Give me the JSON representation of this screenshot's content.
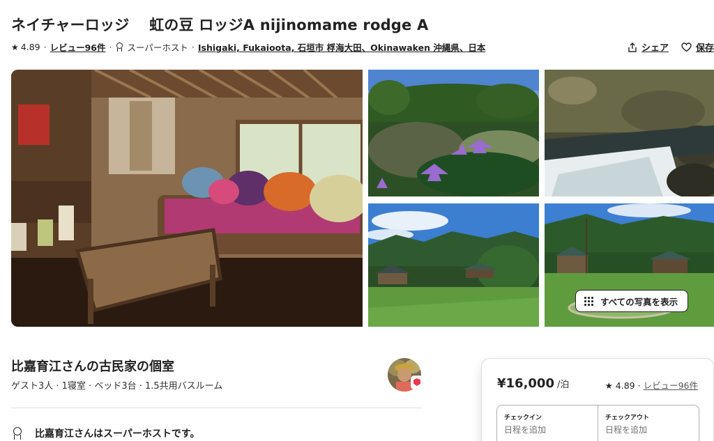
{
  "listing": {
    "title": "ネイチャーロッジ　 虹の豆 ロッジA nijinomame rodge A",
    "rating": "4.89",
    "reviews_link": "レビュー96件",
    "superhost_label": "スーパーホスト",
    "location_link": "Ishigaki, Fukaioota, 石垣市 桴海大田、Okinawaken 沖縄県、日本",
    "separator": "·"
  },
  "actions": {
    "share_label": "シェア",
    "save_label": "保存"
  },
  "gallery": {
    "show_all_label": "すべての写真を表示",
    "photos": [
      "lodge-interior-photo",
      "water-lily-photo",
      "stream-photo",
      "garden-cabins-photo",
      "lawn-cabins-photo"
    ]
  },
  "room": {
    "title": "比嘉育江さんの古民家の個室",
    "details": "ゲスト3人 · 1寝室 · ベッド3台 · 1.5共用バスルーム",
    "superhost_note": "比嘉育江さんはスーパーホストです。"
  },
  "booking": {
    "price": "¥16,000",
    "per_night": "/泊",
    "rating": "4.89",
    "reviews_link": "レビュー96件",
    "checkin_label": "チェックイン",
    "checkin_value": "日程を追加",
    "checkout_label": "チェックアウト",
    "checkout_value": "日程を追加"
  },
  "colors": {
    "text": "#222222",
    "muted": "#717171",
    "brand": "#e8384f",
    "border": "#dddddd"
  }
}
